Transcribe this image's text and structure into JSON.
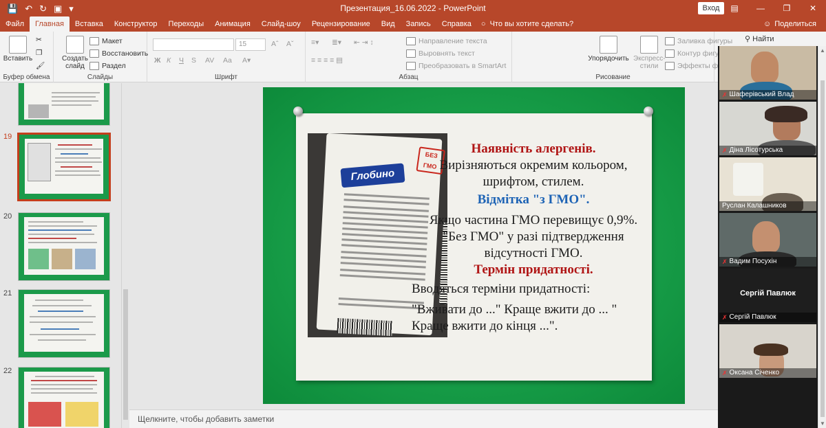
{
  "titlebar": {
    "title": "Презентация_16.06.2022  -  PowerPoint",
    "signin": "Вход"
  },
  "tabs": [
    "Файл",
    "Главная",
    "Вставка",
    "Конструктор",
    "Переходы",
    "Анимация",
    "Слайд-шоу",
    "Рецензирование",
    "Вид",
    "Запись",
    "Справка"
  ],
  "tellme": "Что вы хотите сделать?",
  "share": "Поделиться",
  "ribbon": {
    "paste": "Вставить",
    "clipboard_label": "Буфер обмена",
    "new_slide": "Создать слайд",
    "layout": "Макет",
    "reset": "Восстановить",
    "section": "Раздел",
    "slides_label": "Слайды",
    "font_size": "15",
    "font_label": "Шрифт",
    "bold": "Ж",
    "italic": "К",
    "underline": "Ч",
    "strike": "S",
    "spacing": "AV",
    "case": "Aa",
    "text_direction": "Направление текста",
    "align_text": "Выровнять текст",
    "smartart": "Преобразовать в SmartArt",
    "paragraph_label": "Абзац",
    "arrange": "Упорядочить",
    "quick_styles": "Экспресс-стили",
    "fill": "Заливка фигуры",
    "outline": "Контур фигуры",
    "effects": "Эффекты фигур",
    "drawing_label": "Рисование",
    "find": "Найти"
  },
  "thumbnails": [
    {
      "num": "",
      "selected": false
    },
    {
      "num": "19",
      "selected": true
    },
    {
      "num": "20",
      "selected": false
    },
    {
      "num": "21",
      "selected": false
    },
    {
      "num": "22",
      "selected": false
    }
  ],
  "slide": {
    "h1": "Наявність алергенів.",
    "p1": "Вирізняються окремим кольором, шрифтом, стилем.",
    "h2": "Відмітка \"з ГМО\".",
    "p2": "Якщо частина ГМО перевищує 0,9%. \"Без ГМО\" у разі підтвердження відсутності ГМО.",
    "h3": "Термін придатності.",
    "p3": "Вводяться терміни придатності:",
    "p4": "\"Вживати до ...\" Краще вжити до ... \" Краще вжити до кінця ...\".",
    "product_brand": "Глобино",
    "product_badge": "БЕЗ ГМО"
  },
  "notes": "Щелкните, чтобы добавить заметки",
  "participants": [
    {
      "name": "Шаферівський Влад",
      "muted": true
    },
    {
      "name": "Діна Лісотурська",
      "muted": true
    },
    {
      "name": "Руслан Калашников",
      "muted": true
    },
    {
      "name": "Вадим Посухін",
      "muted": true
    },
    {
      "name": "Сергій Павлюк",
      "muted": true,
      "no_video_label": "Сергій Павлюк"
    },
    {
      "name": "Оксана Січенко",
      "muted": true
    }
  ]
}
